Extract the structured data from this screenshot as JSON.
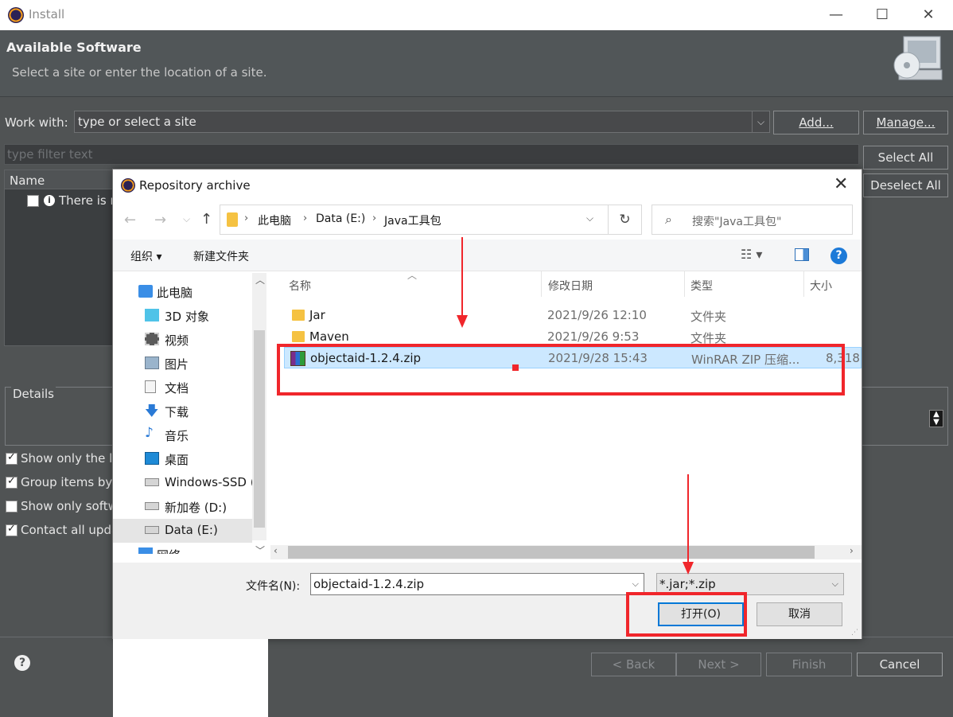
{
  "window": {
    "title": "Install",
    "minimize": "—",
    "maximize": "☐",
    "close": "✕"
  },
  "header": {
    "title": "Available Software",
    "subtitle": "Select a site or enter the location of a site."
  },
  "work_with": {
    "label": "Work with:",
    "value": "type or select a site",
    "add_button": "Add...",
    "manage_button": "Manage..."
  },
  "filter": {
    "placeholder": "type filter text"
  },
  "selection_buttons": {
    "select_all": "Select All",
    "deselect_all": "Deselect All"
  },
  "tree": {
    "column": "Name",
    "info_text": "There is n"
  },
  "details": {
    "label": "Details"
  },
  "options": [
    {
      "label": "Show only the la",
      "checked": true
    },
    {
      "label": "Group items by",
      "checked": true
    },
    {
      "label": "Show only softw",
      "checked": false
    },
    {
      "label": "Contact all upda",
      "checked": true
    }
  ],
  "wizard_buttons": {
    "back": "< Back",
    "next": "Next >",
    "finish": "Finish",
    "cancel": "Cancel"
  },
  "dialog": {
    "title": "Repository archive",
    "close": "✕",
    "breadcrumb": [
      "此电脑",
      "Data (E:)",
      "Java工具包"
    ],
    "search_placeholder": "搜索\"Java工具包\"",
    "toolbar": {
      "organize": "组织 ▾",
      "new_folder": "新建文件夹"
    },
    "nav_items": [
      {
        "label": "此电脑",
        "icon": "computer-icon"
      },
      {
        "label": "3D 对象",
        "icon": "cube-icon"
      },
      {
        "label": "视频",
        "icon": "video-icon"
      },
      {
        "label": "图片",
        "icon": "picture-icon"
      },
      {
        "label": "文档",
        "icon": "document-icon"
      },
      {
        "label": "下载",
        "icon": "download-icon"
      },
      {
        "label": "音乐",
        "icon": "music-icon"
      },
      {
        "label": "桌面",
        "icon": "desktop-icon"
      },
      {
        "label": "Windows-SSD (",
        "icon": "drive-icon"
      },
      {
        "label": "新加卷 (D:)",
        "icon": "drive-icon"
      },
      {
        "label": "Data (E:)",
        "icon": "drive-icon"
      },
      {
        "label": "网络",
        "icon": "network-icon"
      }
    ],
    "columns": {
      "name": "名称",
      "date": "修改日期",
      "type": "类型",
      "size": "大小"
    },
    "files": [
      {
        "name": "Jar",
        "date": "2021/9/26 12:10",
        "type": "文件夹",
        "size": "",
        "kind": "folder"
      },
      {
        "name": "Maven",
        "date": "2021/9/26 9:53",
        "type": "文件夹",
        "size": "",
        "kind": "folder"
      },
      {
        "name": "objectaid-1.2.4.zip",
        "date": "2021/9/28 15:43",
        "type": "WinRAR ZIP 压缩...",
        "size": "8,318",
        "kind": "zip",
        "selected": true
      }
    ],
    "filename_label": "文件名(N):",
    "filename_value": "objectaid-1.2.4.zip",
    "filetype_value": "*.jar;*.zip",
    "open_button": "打开(O)",
    "cancel_button": "取消"
  },
  "colors": {
    "annotation": "#f0262b",
    "eclipse_bg": "#505354",
    "selection": "#cce8ff",
    "help_blue": "#1c7ad8"
  }
}
